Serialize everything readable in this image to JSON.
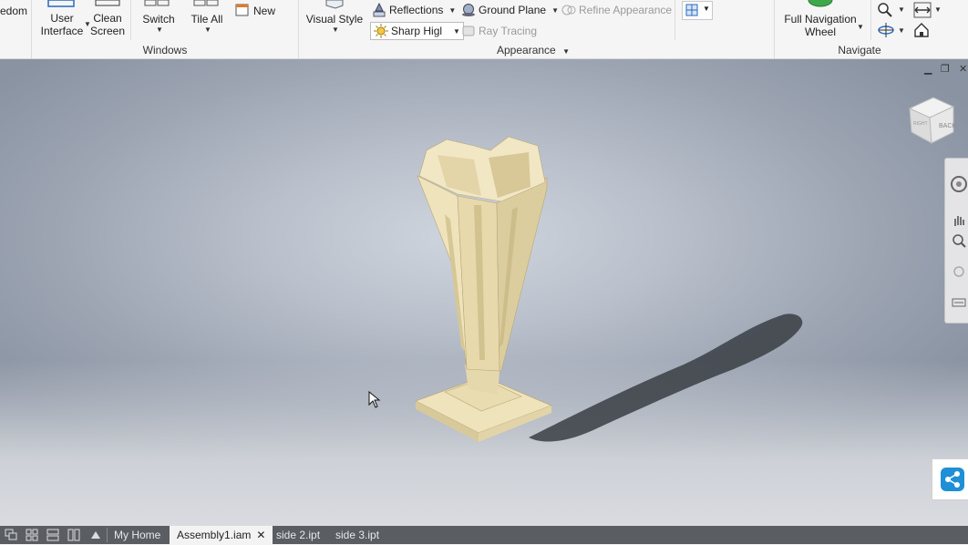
{
  "ribbon": {
    "partial_left_label": "edom",
    "windows": {
      "user_interface": "User\nInterface",
      "clean_screen": "Clean\nScreen",
      "switch": "Switch",
      "tile_all": "Tile All",
      "new": "New",
      "title": "Windows"
    },
    "appearance": {
      "visual_style": "Visual Style",
      "reflections": "Reflections",
      "ground_plane": "Ground Plane",
      "refine_appearance": "Refine Appearance",
      "sharp_highlights": "Sharp Higl",
      "ray_tracing": "Ray Tracing",
      "title": "Appearance"
    },
    "navigate": {
      "full_navigation_wheel": "Full Navigation\nWheel",
      "title": "Navigate"
    }
  },
  "viewcube": {
    "face_label": "BACK",
    "side_label": "RIGHT"
  },
  "tabs": {
    "my_home": "My Home",
    "assembly": "Assembly1.iam",
    "close": "✕",
    "side2": "side 2.ipt",
    "side3": "side 3.ipt"
  },
  "colors": {
    "model": "#efe3bc",
    "model_shade": "#d8c99a",
    "tabbar": "#5a5d62",
    "share_button": "#1f8fd6"
  }
}
